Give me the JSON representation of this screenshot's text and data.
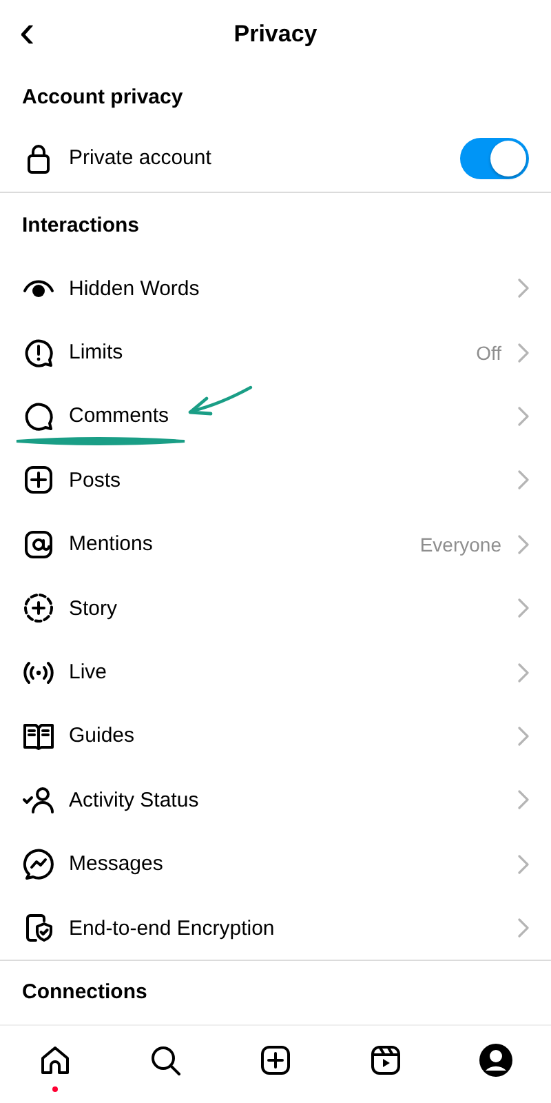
{
  "header": {
    "back": "‹",
    "title": "Privacy"
  },
  "account_privacy": {
    "title": "Account privacy",
    "private_account": {
      "label": "Private account",
      "on": true
    }
  },
  "interactions": {
    "title": "Interactions",
    "items": [
      {
        "label": "Hidden Words",
        "highlighted": false
      },
      {
        "label": "Limits",
        "value": "Off",
        "highlighted": false
      },
      {
        "label": "Comments",
        "highlighted": true
      },
      {
        "label": "Posts",
        "highlighted": false
      },
      {
        "label": "Mentions",
        "value": "Everyone",
        "highlighted": false
      },
      {
        "label": "Story",
        "highlighted": false
      },
      {
        "label": "Live",
        "highlighted": false
      },
      {
        "label": "Guides",
        "highlighted": false
      },
      {
        "label": "Activity Status",
        "highlighted": false
      },
      {
        "label": "Messages",
        "highlighted": false
      },
      {
        "label": "End-to-end Encryption",
        "highlighted": false
      }
    ]
  },
  "connections": {
    "title": "Connections"
  },
  "bottom_nav": [
    {
      "notification": true
    },
    {
      "notification": false
    },
    {
      "notification": false
    },
    {
      "notification": false
    },
    {
      "notification": false
    }
  ]
}
